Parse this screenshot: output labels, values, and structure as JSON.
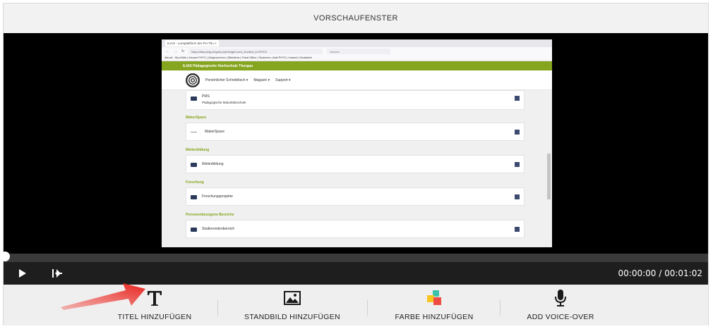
{
  "header": {
    "title": "VORSCHAUFENSTER"
  },
  "player": {
    "time": "00:00:00 / 00:01:02",
    "progress": 0
  },
  "toolbar": {
    "title_label": "TITEL HINZUFÜGEN",
    "still_label": "STANDBILD HINZUFÜGEN",
    "color_label": "FARBE HINZUFÜGEN",
    "voice_label": "ADD VOICE-OVER"
  },
  "preview": {
    "tab_title": "ILIAS - Lernplattform der PH Thu ×",
    "url": "https://ilias.phtg.ch/goto.php?target=root_1&client_id=PHTG",
    "search": "Suchen",
    "bookmarks": "Aktuell - Stud.Hilfe   |   Intranet PHTG   |   Zeitgeschehen   |   Bibliothek   |   Portal Office   |   Studenten   |   Mail PHTG   |   Intranet   |   Mediathek",
    "site_name": "ILIAS Pädagogische Hochschule Thurgau",
    "nav": [
      "Persönlicher Schreibtisch ▾",
      "Magazin ▾",
      "Support ▾"
    ],
    "cards": [
      {
        "title": "PMS",
        "subtitle": "Pädagogische Maturitätsschule"
      },
      {
        "section": "MakerSpace",
        "title": "MakerSpace"
      },
      {
        "section": "Weiterbildung",
        "title": "Weiterbildung"
      },
      {
        "section": "Forschung",
        "title": "Forschungsprojekte"
      },
      {
        "section": "Personenbezogene Bereiche",
        "title": "Studierendenbereich"
      }
    ]
  },
  "colors": {
    "ilias_green": "#86a51e",
    "arrow_red": "#e8231d"
  }
}
